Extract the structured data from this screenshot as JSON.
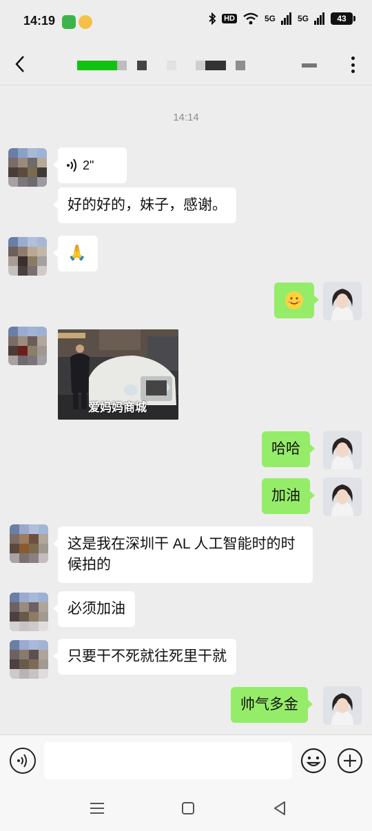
{
  "status_bar": {
    "time": "14:19",
    "hd_label": "HD",
    "net_label_1": "5G",
    "net_label_2": "5G",
    "battery": "43",
    "accent_green": "#2db34a"
  },
  "nav": {
    "back_icon": "chevron-left-icon",
    "more_icon": "more-vertical-icon"
  },
  "chat": {
    "timestamp": "14:14",
    "messages": [
      {
        "side": "left",
        "type": "voice",
        "duration": "2\""
      },
      {
        "side": "left",
        "type": "text",
        "text": "好的好的，妹子，感谢。"
      },
      {
        "side": "left",
        "type": "emoji",
        "emoji": "🙏"
      },
      {
        "side": "right",
        "type": "emoji",
        "emoji": "smile-emoji"
      },
      {
        "side": "left",
        "type": "image",
        "caption": "爱妈妈商城"
      },
      {
        "side": "right",
        "type": "text",
        "text": "哈哈"
      },
      {
        "side": "right",
        "type": "text",
        "text": "加油"
      },
      {
        "side": "left",
        "type": "text",
        "line1": "这是我在深圳干 AL 人工智能时的时",
        "line2": "候拍的"
      },
      {
        "side": "left",
        "type": "text",
        "text": "必须加油"
      },
      {
        "side": "left",
        "type": "text",
        "text": "只要干不死就往死里干就"
      },
      {
        "side": "right",
        "type": "text",
        "text": "帅气多金"
      }
    ]
  },
  "input_bar": {
    "placeholder": "",
    "voice_icon": "voice-icon",
    "emoji_icon": "emoji-icon",
    "plus_icon": "plus-icon"
  },
  "colors": {
    "background": "#ededed",
    "bubble_self": "#95ec69",
    "bubble_other": "#ffffff",
    "timestamp": "#8d8d8d"
  }
}
